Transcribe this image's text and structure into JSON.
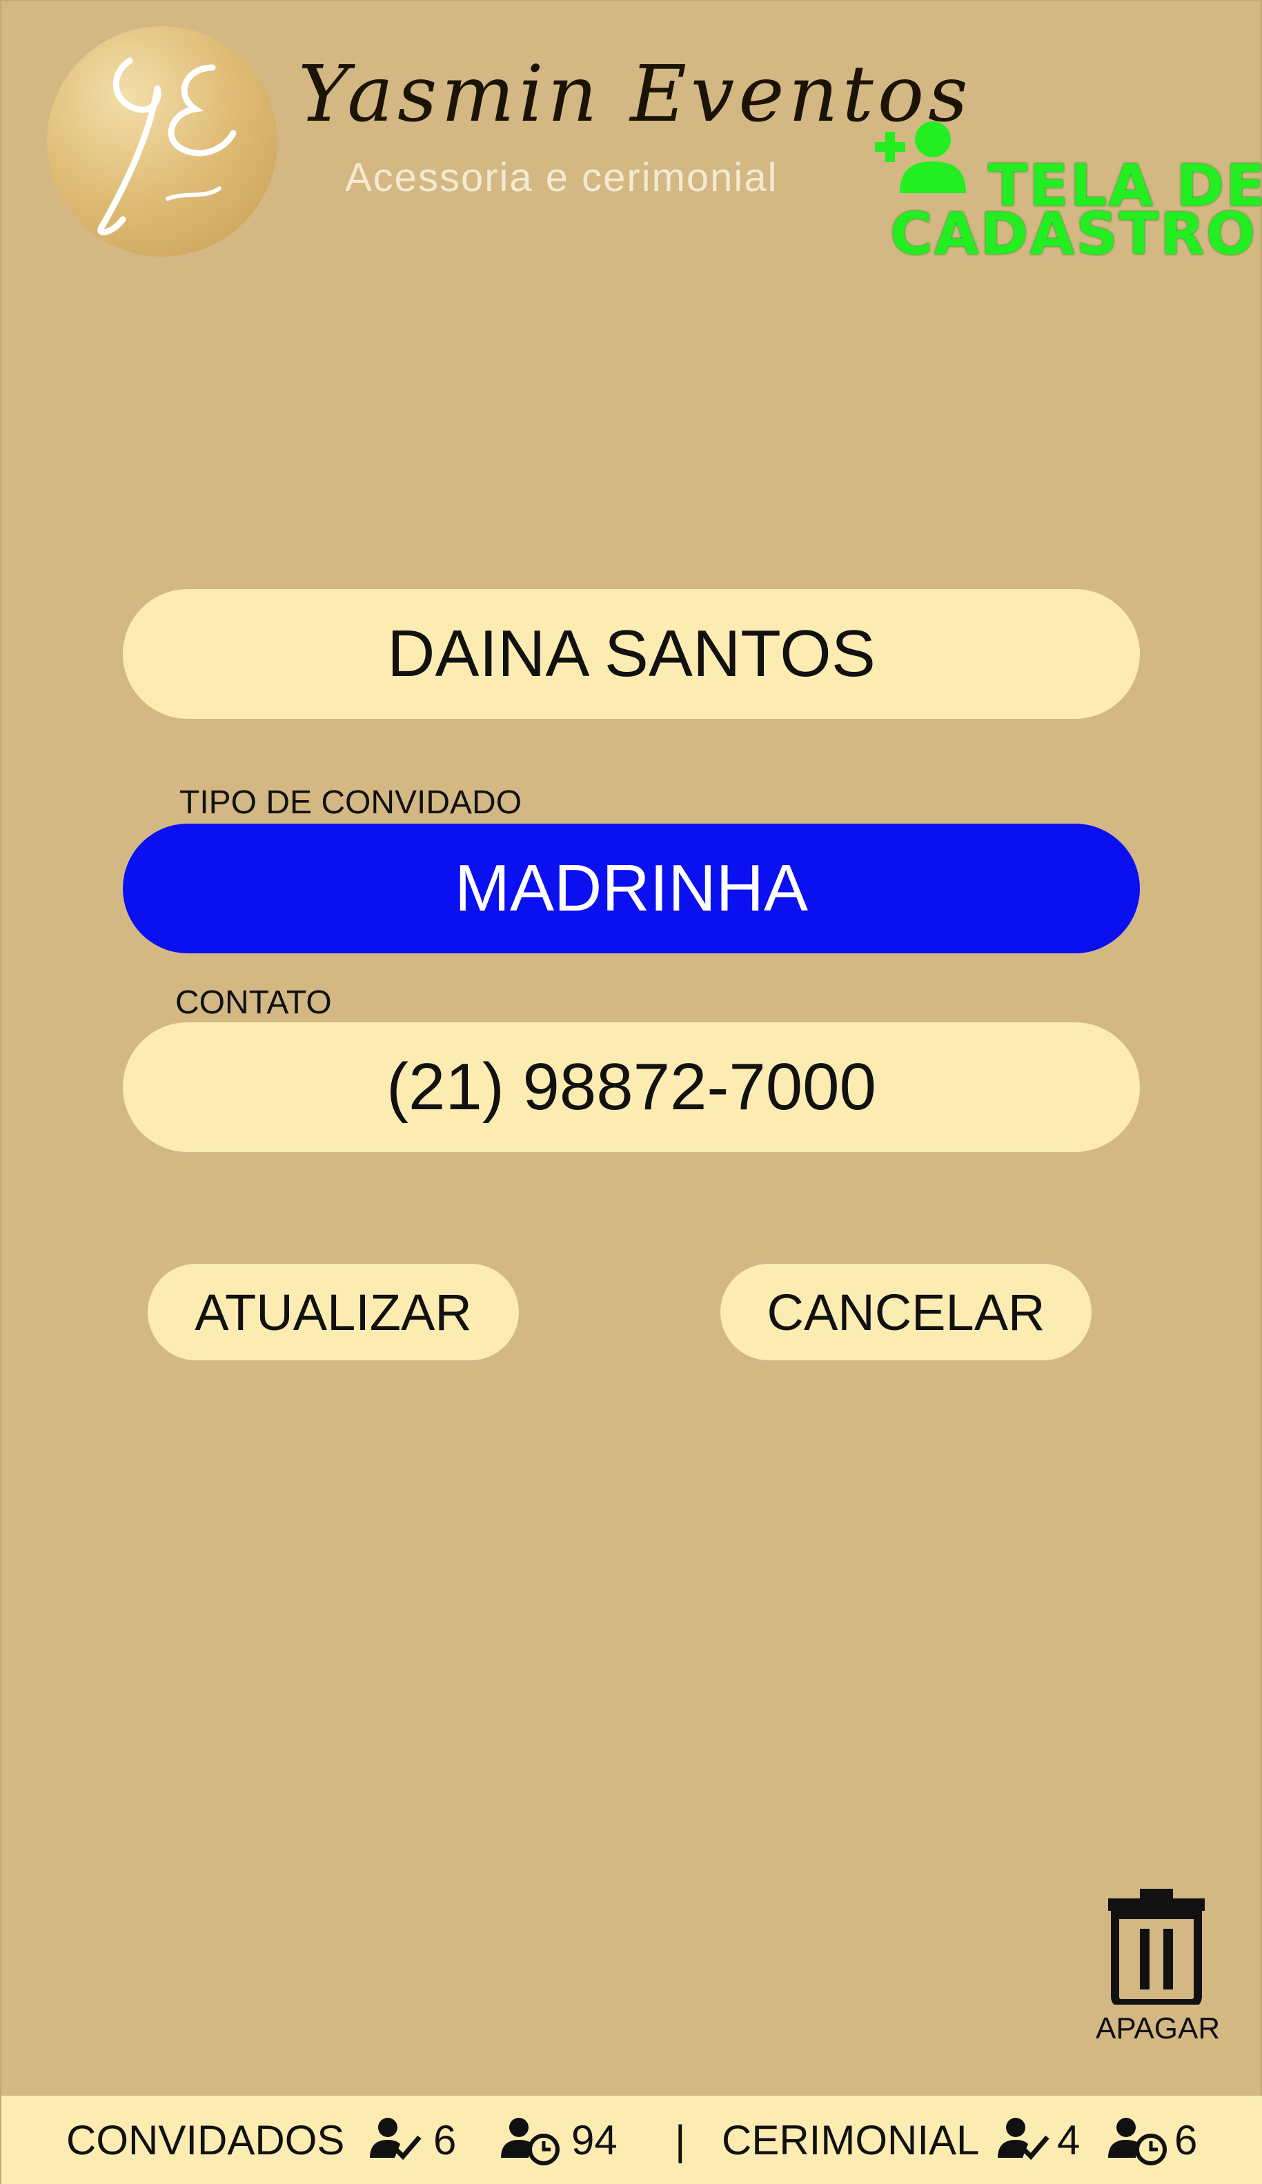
{
  "header": {
    "logo_monogram": "YE",
    "brand_name": "Yasmin Eventos",
    "brand_tagline": "Acessoria e cerimonial",
    "screen_title_line1": "TELA DE",
    "screen_title_line2": "CADASTRO",
    "screen_title_icon": "add-user-icon",
    "screen_title_color": "#22ee22"
  },
  "form": {
    "name_value": "DAINA SANTOS",
    "guest_type_label": "TIPO DE CONVIDADO",
    "guest_type_value": "MADRINHA",
    "guest_type_color": "#0b10f0",
    "contact_label": "CONTATO",
    "contact_value": "(21) 98872-7000"
  },
  "actions": {
    "update_label": "ATUALIZAR",
    "cancel_label": "CANCELAR",
    "delete_label": "APAGAR",
    "delete_icon": "trash-icon"
  },
  "footer": {
    "guests_label": "CONVIDADOS",
    "guests_confirmed": "6",
    "guests_pending": "94",
    "separator": "|",
    "ceremonial_label": "CERIMONIAL",
    "ceremonial_confirmed": "4",
    "ceremonial_pending": "6",
    "confirmed_icon": "user-check-icon",
    "pending_icon": "user-clock-icon"
  },
  "colors": {
    "background": "#d3b884",
    "field_background": "#fcecb2"
  }
}
